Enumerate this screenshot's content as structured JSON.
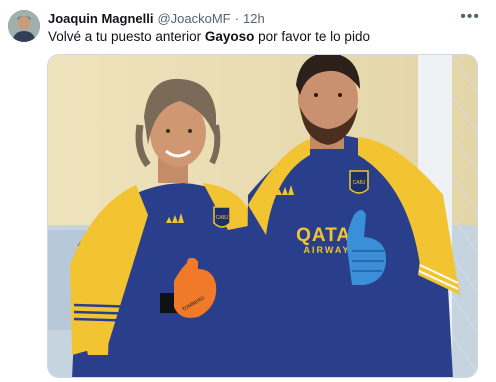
{
  "post": {
    "author_name": "Joaquin Magnelli",
    "author_handle": "@JoackoMF",
    "separator": "·",
    "time": "12h",
    "text_before": "Volvé a tu puesto anterior ",
    "text_bold": "Gayoso",
    "text_after": " por favor te lo pido",
    "more_icon": "more-horizontal-icon"
  },
  "photo": {
    "jersey_sponsor_line1": "QATAR",
    "jersey_sponsor_line2": "AIRWAYS",
    "crest_text": "CABJ",
    "glove_text": "TOMBERG"
  }
}
